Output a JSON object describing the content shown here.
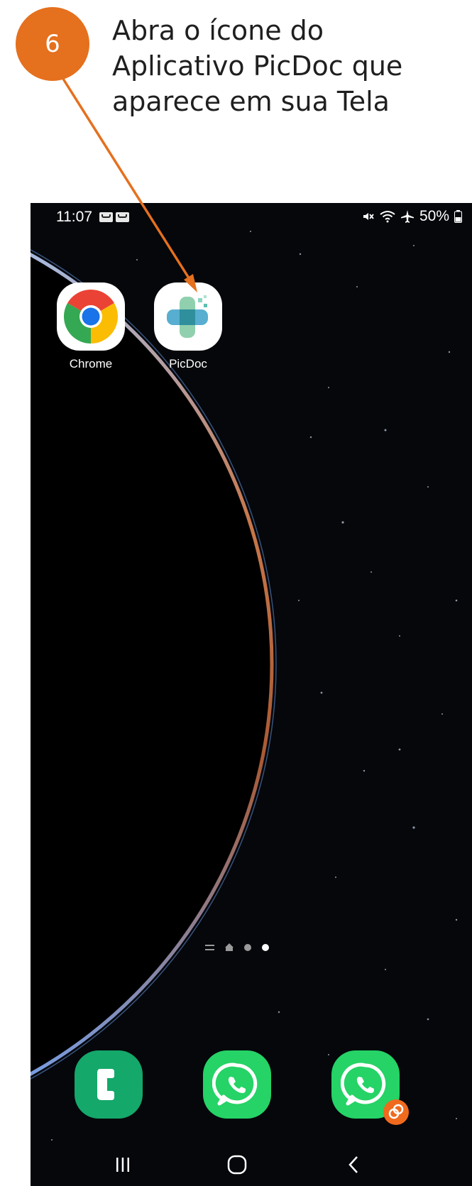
{
  "annotation": {
    "step_number": "6",
    "instruction": "Abra o ícone do Aplicativo PicDoc que aparece em sua Tela",
    "accent_color": "#e5701e"
  },
  "status_bar": {
    "time": "11:07",
    "left_icons": [
      "voicemail-icon",
      "voicemail-icon"
    ],
    "right_icons": [
      "mute-icon",
      "wifi-icon",
      "airplane-mode-icon",
      "battery-icon"
    ],
    "battery_percent": "50%"
  },
  "home_apps": [
    {
      "label": "Chrome",
      "icon": "chrome-icon"
    },
    {
      "label": "PicDoc",
      "icon": "picdoc-icon"
    }
  ],
  "page_indicator": {
    "pages": 3,
    "active_index": 2
  },
  "dock": [
    {
      "icon": "phone-icon",
      "color": "#14a86a"
    },
    {
      "icon": "whatsapp-icon",
      "color": "#25d366"
    },
    {
      "icon": "whatsapp-business-icon",
      "color": "#25d366",
      "badge_color": "#f06a1e"
    }
  ],
  "nav_bar": [
    "recents-icon",
    "home-icon",
    "back-icon"
  ]
}
